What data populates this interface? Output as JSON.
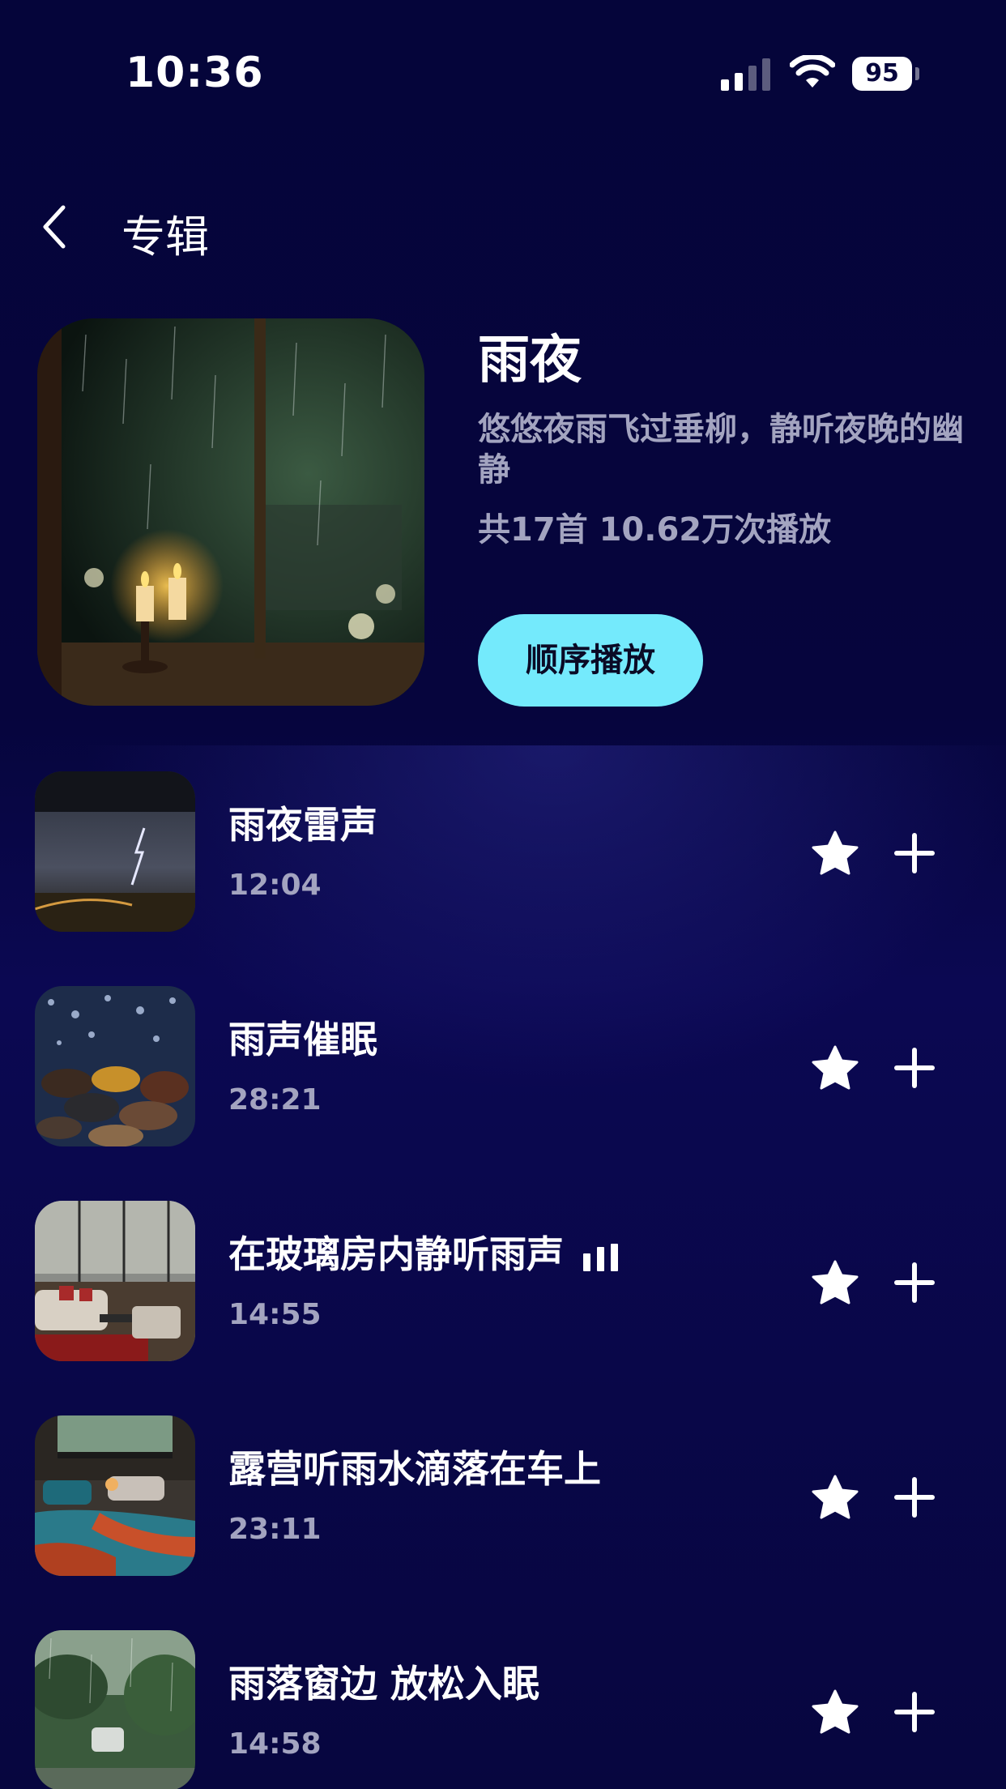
{
  "status_bar": {
    "time": "10:36",
    "battery": "95",
    "icons": [
      "signal-icon",
      "wifi-icon",
      "battery-icon"
    ]
  },
  "nav": {
    "back_icon": "chevron-left-icon",
    "title": "专辑"
  },
  "album": {
    "title": "雨夜",
    "description": "悠悠夜雨飞过垂柳，静听夜晚的幽静",
    "stats": "共17首 10.62万次播放",
    "play_label": "顺序播放",
    "accent_color": "#74eafc"
  },
  "tracks": [
    {
      "name": "雨夜雷声",
      "duration": "12:04",
      "playing": false
    },
    {
      "name": "雨声催眠",
      "duration": "28:21",
      "playing": false
    },
    {
      "name": "在玻璃房内静听雨声",
      "duration": "14:55",
      "playing": true
    },
    {
      "name": "露营听雨水滴落在车上",
      "duration": "23:11",
      "playing": false
    },
    {
      "name": "雨落窗边 放松入眠",
      "duration": "14:58",
      "playing": false
    }
  ],
  "track_actions": {
    "favorite_icon": "star-icon",
    "add_icon": "plus-icon"
  }
}
